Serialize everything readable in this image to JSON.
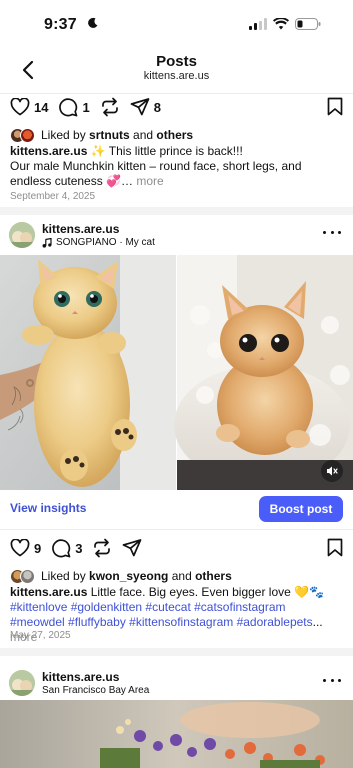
{
  "status": {
    "time": "9:37"
  },
  "header": {
    "title": "Posts",
    "subtitle": "kittens.are.us"
  },
  "post1": {
    "likes": "14",
    "comments": "1",
    "shares": "8",
    "liked_prefix": "Liked by ",
    "liked_user": "srtnuts",
    "liked_and": " and ",
    "liked_others": "others",
    "caption_user": "kittens.are.us",
    "caption_line1": " ✨ This little prince is back!!!",
    "caption_line2": "Our male Munchkin kitten – round face, short legs, and endless cuteness 💞",
    "caption_ellipsis": "… ",
    "more": "more",
    "date": "September 4, 2025"
  },
  "post2": {
    "username": "kittens.are.us",
    "audio": "SONGPIANO · My cat",
    "view_insights": "View insights",
    "boost": "Boost post",
    "likes": "9",
    "comments": "3",
    "liked_prefix": "Liked by ",
    "liked_user": "kwon_syeong",
    "liked_and": " and ",
    "liked_others": "others",
    "caption_user": "kittens.are.us",
    "caption_text": " Little face. Big eyes. Even bigger love 💛🐾",
    "hashtags": "#kittenlove #goldenkitten #cutecat #catsofinstagram #meowdel #fluffybaby #kittensofinstagram #adorablepets",
    "caption_ellipsis": "... ",
    "more": "more",
    "date": "May 27, 2025"
  },
  "post3": {
    "username": "kittens.are.us",
    "location": "San Francisco Bay Area"
  },
  "colors": {
    "accent": "#4a5df9",
    "link": "#3f51d6",
    "muted": "#8e8e8e"
  }
}
